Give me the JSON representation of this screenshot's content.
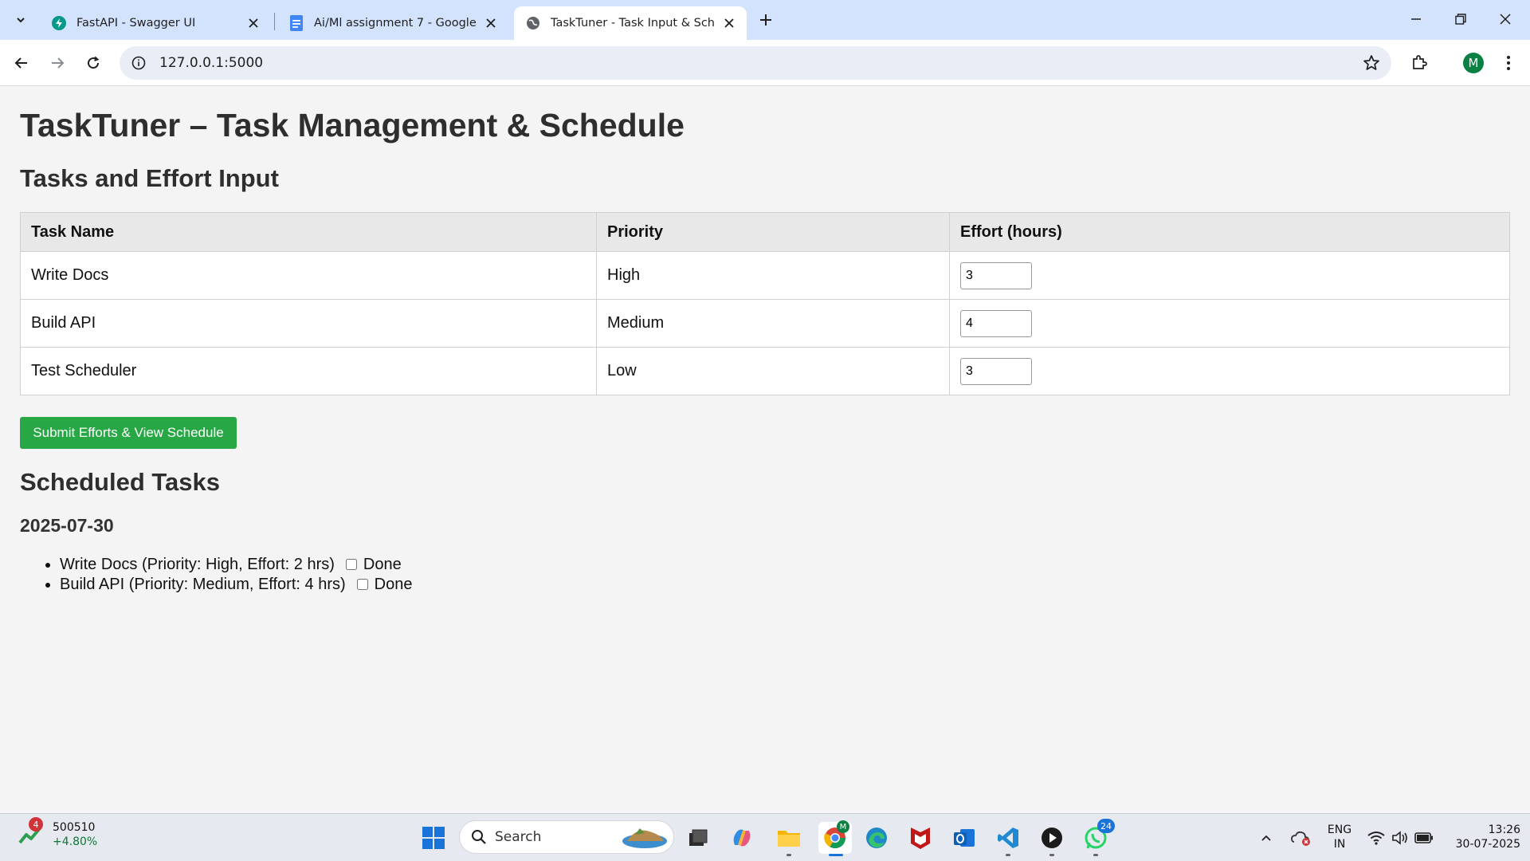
{
  "browser": {
    "tabs": [
      {
        "title": "FastAPI - Swagger UI",
        "icon": "fastapi-icon"
      },
      {
        "title": "Ai/Ml assignment 7 - Google Docs",
        "icon": "google-docs-icon"
      },
      {
        "title": "TaskTuner - Task Input & Schedule",
        "icon": "globe-icon",
        "active": true
      }
    ],
    "url": "127.0.0.1:5000",
    "profile_initial": "M"
  },
  "page": {
    "title": "TaskTuner – Task Management & Schedule",
    "input_heading": "Tasks and Effort Input",
    "table": {
      "headers": [
        "Task Name",
        "Priority",
        "Effort (hours)"
      ],
      "rows": [
        {
          "task": "Write Docs",
          "priority": "High",
          "effort": "3"
        },
        {
          "task": "Build API",
          "priority": "Medium",
          "effort": "4"
        },
        {
          "task": "Test Scheduler",
          "priority": "Low",
          "effort": "3"
        }
      ]
    },
    "submit_label": "Submit Efforts & View Schedule",
    "schedule_heading": "Scheduled Tasks",
    "schedule_date": "2025-07-30",
    "scheduled_items": [
      {
        "text": "Write Docs (Priority: High, Effort: 2 hrs)",
        "done_label": "Done",
        "done": false
      },
      {
        "text": "Build API (Priority: Medium, Effort: 4 hrs)",
        "done_label": "Done",
        "done": false
      }
    ],
    "accent_color": "#28a745"
  },
  "taskbar": {
    "widget": {
      "badge": "4",
      "value": "500510",
      "change": "+4.80%"
    },
    "search_label": "Search",
    "whatsapp_badge": "24",
    "language": "ENG",
    "region": "IN",
    "time": "13:26",
    "date": "30-07-2025"
  }
}
